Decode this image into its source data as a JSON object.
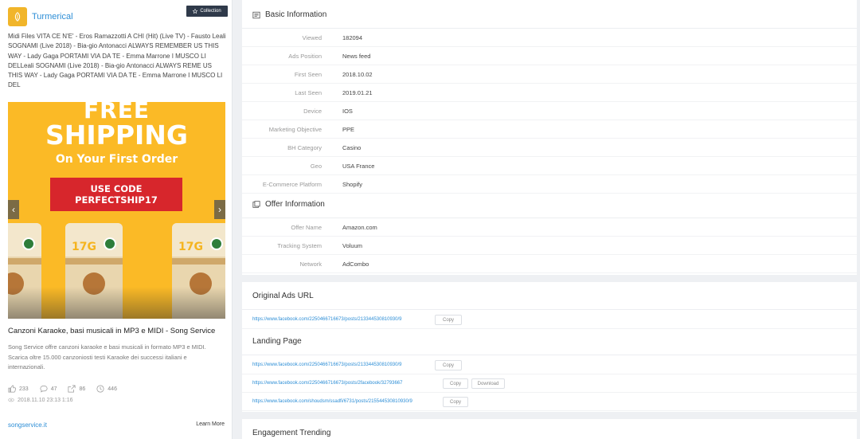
{
  "ad": {
    "brand": "Turmerical",
    "collection_label": "Collection",
    "text": "Midi Files VITA CE N'E' - Eros Ramazzotti A CHI (Hit) (Live TV) - Fausto Leali SOGNAMI (Live 2018) - Bia-gio Antonacci ALWAYS REMEMBER US THIS WAY - Lady Gaga PORTAMI VIA DA TE - Emma Marrone I MUSCO LI DELLeali SOGNAMI (Live 2018) - Bia-gio Antonacci ALWAYS REME US THIS WAY - Lady Gaga PORTAMI VIA DA TE - Emma Marrone I MUSCO LI DEL",
    "creative": {
      "line1": "FREE",
      "line2": "SHIPPING",
      "line3": "On Your First Order",
      "code_line1": "USE CODE",
      "code_line2": "PERFECTSHIP17",
      "bag_label": "17G",
      "prev_icon": "chevron-left-icon",
      "next_icon": "chevron-right-icon"
    },
    "title": "Canzoni Karaoke, basi musicali in MP3 e MIDI - Song Service",
    "description": "Song Service offre canzoni karaoke e basi musicali in formato MP3 e MIDI. Scarica oltre 15.000 canzoniosti testi Karaoke dei successi italiani e internazionali.",
    "stats": {
      "likes": "233",
      "comments": "47",
      "shares": "86",
      "views": "446"
    },
    "date": "2018.11.10 23:13 1:16",
    "site": "songservice.it",
    "cta": "Learn More"
  },
  "basic": {
    "title": "Basic Information",
    "rows": [
      {
        "label": "Viewed",
        "value": "182094"
      },
      {
        "label": "Ads Position",
        "value": "News feed"
      },
      {
        "label": "First Seen",
        "value": "2018.10.02"
      },
      {
        "label": "Last Seen",
        "value": "2019.01.21"
      },
      {
        "label": "Device",
        "value": "IOS"
      },
      {
        "label": "Marketing Objective",
        "value": "PPE"
      },
      {
        "label": "BH Category",
        "value": "Casino"
      },
      {
        "label": "Geo",
        "value": "USA    France"
      },
      {
        "label": "E-Commerce Platform",
        "value": "Shopify"
      }
    ]
  },
  "offer": {
    "title": "Offer Information",
    "rows": [
      {
        "label": "Offer Name",
        "value": "Amazon.com"
      },
      {
        "label": "Tracking System",
        "value": "Voluum"
      },
      {
        "label": "Network",
        "value": "AdCombo"
      }
    ]
  },
  "original_url": {
    "title": "Original Ads URL",
    "url": "https://www.facebook.com/2250466716673/posts/213344530810930/9",
    "copy_label": "Copy"
  },
  "landing": {
    "title": "Landing Page",
    "rows": [
      {
        "url": "https://www.facebook.com/2250466716673/posts/213344530810930/9",
        "copy_label": "Copy"
      },
      {
        "url": "https://www.facebook.com/2250466716673/posts/2facebook/32793667",
        "copy_label": "Copy",
        "extra_label": "Download"
      },
      {
        "url": "https://www.facebook.com/shoudsm/ssadfi/6731/posts/215544530810930/9",
        "copy_label": "Copy"
      }
    ]
  },
  "engagement": {
    "title": "Engagement Trending"
  },
  "colors": {
    "accent": "#2d8ed6",
    "brand": "#f1b52a",
    "creative_bg": "#fbba26",
    "code_red": "#d7262c"
  }
}
